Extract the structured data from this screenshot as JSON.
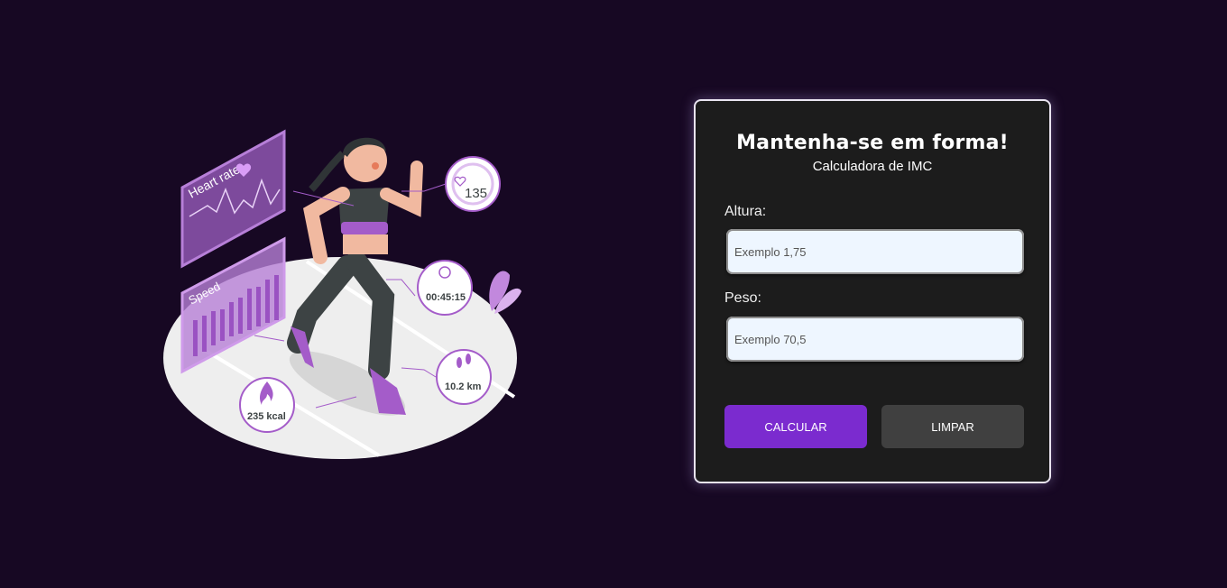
{
  "theme": {
    "page_bg": "#170823",
    "card_bg": "#1c1c1c",
    "primary_button": "#7b2bcf",
    "secondary_button": "#404040",
    "illustration_accent": "#a45cc9"
  },
  "illustration": {
    "heart_rate_label": "Heart rate",
    "speed_label": "Speed",
    "bpm_value": "135",
    "timer_value": "00:45:15",
    "distance_value": "10.2 km",
    "calories_value": "235 kcal"
  },
  "form": {
    "title": "Mantenha-se em forma!",
    "subtitle": "Calculadora de IMC",
    "height_label": "Altura:",
    "height_placeholder": "Exemplo 1,75",
    "height_value": "",
    "weight_label": "Peso:",
    "weight_placeholder": "Exemplo 70,5",
    "weight_value": "",
    "calculate_label": "CALCULAR",
    "clear_label": "LIMPAR"
  }
}
